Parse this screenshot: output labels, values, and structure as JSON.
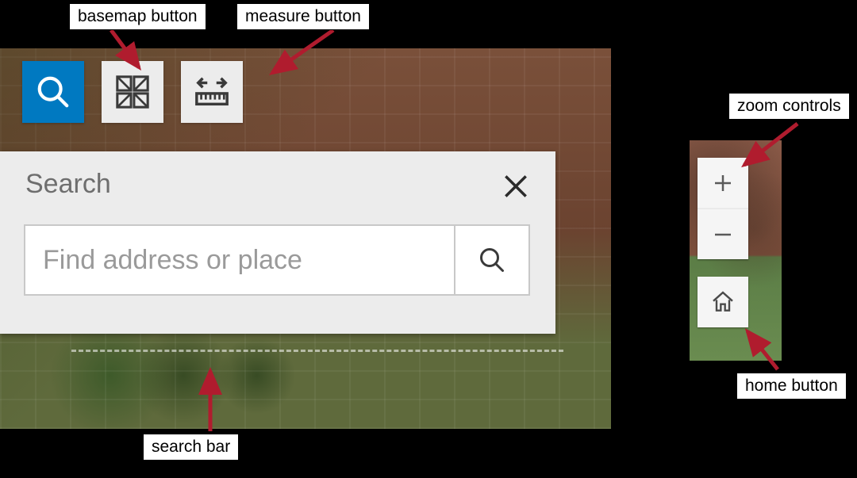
{
  "callouts": {
    "basemap": "basemap button",
    "measure": "measure button",
    "searchbar": "search bar",
    "zoom": "zoom controls",
    "home": "home button"
  },
  "toolbar": {
    "search_icon": "search-icon",
    "basemap_icon": "basemap-icon",
    "measure_icon": "measure-icon"
  },
  "search_panel": {
    "title": "Search",
    "placeholder": "Find address or place",
    "close_icon": "close-icon",
    "submit_icon": "search-icon"
  },
  "zoom": {
    "in_icon": "plus-icon",
    "out_icon": "minus-icon",
    "home_icon": "home-icon"
  },
  "colors": {
    "accent": "#0079c1"
  }
}
